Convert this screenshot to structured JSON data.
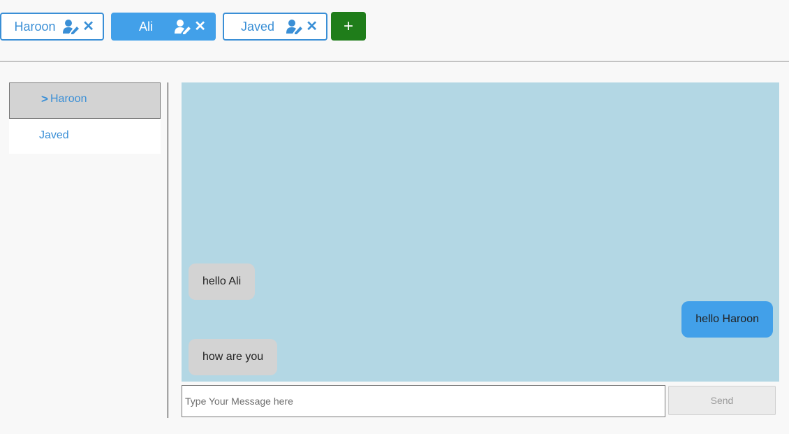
{
  "tabs": [
    {
      "label": "Haroon",
      "edit_icon": "user-edit-icon",
      "close_icon": "close-icon"
    },
    {
      "label": "Ali",
      "edit_icon": "user-edit-icon",
      "close_icon": "close-icon",
      "active": true
    },
    {
      "label": "Javed",
      "edit_icon": "user-edit-icon",
      "close_icon": "close-icon"
    }
  ],
  "add_button": {
    "label": "+"
  },
  "sidebar": {
    "items": [
      {
        "label": "Haroon",
        "selected": true,
        "icon": "chevron-right-icon"
      },
      {
        "label": "Javed",
        "selected": false
      }
    ]
  },
  "chat": {
    "messages": [
      {
        "text": "hello Ali",
        "direction": "incoming"
      },
      {
        "text": "hello Haroon",
        "direction": "outgoing"
      },
      {
        "text": "how are you",
        "direction": "incoming"
      }
    ]
  },
  "composer": {
    "placeholder": "Type Your Message here",
    "send_label": "Send"
  },
  "colors": {
    "accent": "#42a0e9",
    "add_button": "#1f7d1a",
    "chat_background": "#b3d7e4",
    "incoming_bubble": "#d3d3d3"
  }
}
